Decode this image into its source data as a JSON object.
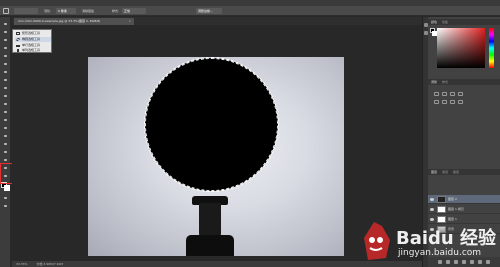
{
  "document_tab": {
    "title": "mm.chim-0000-0-example.jpg @ 33.3%(图层 2, RGB/8)",
    "close": "×"
  },
  "options_bar": {
    "feather_label": "羽化:",
    "feather_value": "0 像素",
    "antialias_label": "消除锯齿",
    "style_label": "样式:",
    "style_value": "正常",
    "refine_button": "调整边缘..."
  },
  "tool_flyout": {
    "items": [
      {
        "label": "矩形选框工具",
        "key": "M",
        "active": false
      },
      {
        "label": "椭圆选框工具",
        "key": "M",
        "active": true
      },
      {
        "label": "单行选框工具",
        "key": "",
        "active": false
      },
      {
        "label": "单列选框工具",
        "key": "",
        "active": false
      }
    ]
  },
  "status_bar": {
    "zoom": "33.33%",
    "doc_info": "文档:3.96M/7.91M"
  },
  "panels": {
    "color_tab": "颜色",
    "swatches_tab": "色板",
    "adjustments_tab": "调整",
    "styles_tab": "样式",
    "layers_tab": "图层",
    "channels_tab": "通道",
    "paths_tab": "路径"
  },
  "layers": [
    {
      "name": "图层 2",
      "selected": true,
      "thumb": "dark"
    },
    {
      "name": "图层 1 拷贝",
      "selected": false,
      "thumb": "light"
    },
    {
      "name": "图层 1",
      "selected": false,
      "thumb": "light"
    },
    {
      "name": "背景",
      "selected": false,
      "thumb": "photo"
    }
  ],
  "watermark": {
    "brand": "Baidu 经验",
    "url": "jingyan.baidu.com"
  },
  "colors": {
    "selection_box": "#e23030",
    "foreground": "#000000",
    "background": "#ffffff"
  }
}
